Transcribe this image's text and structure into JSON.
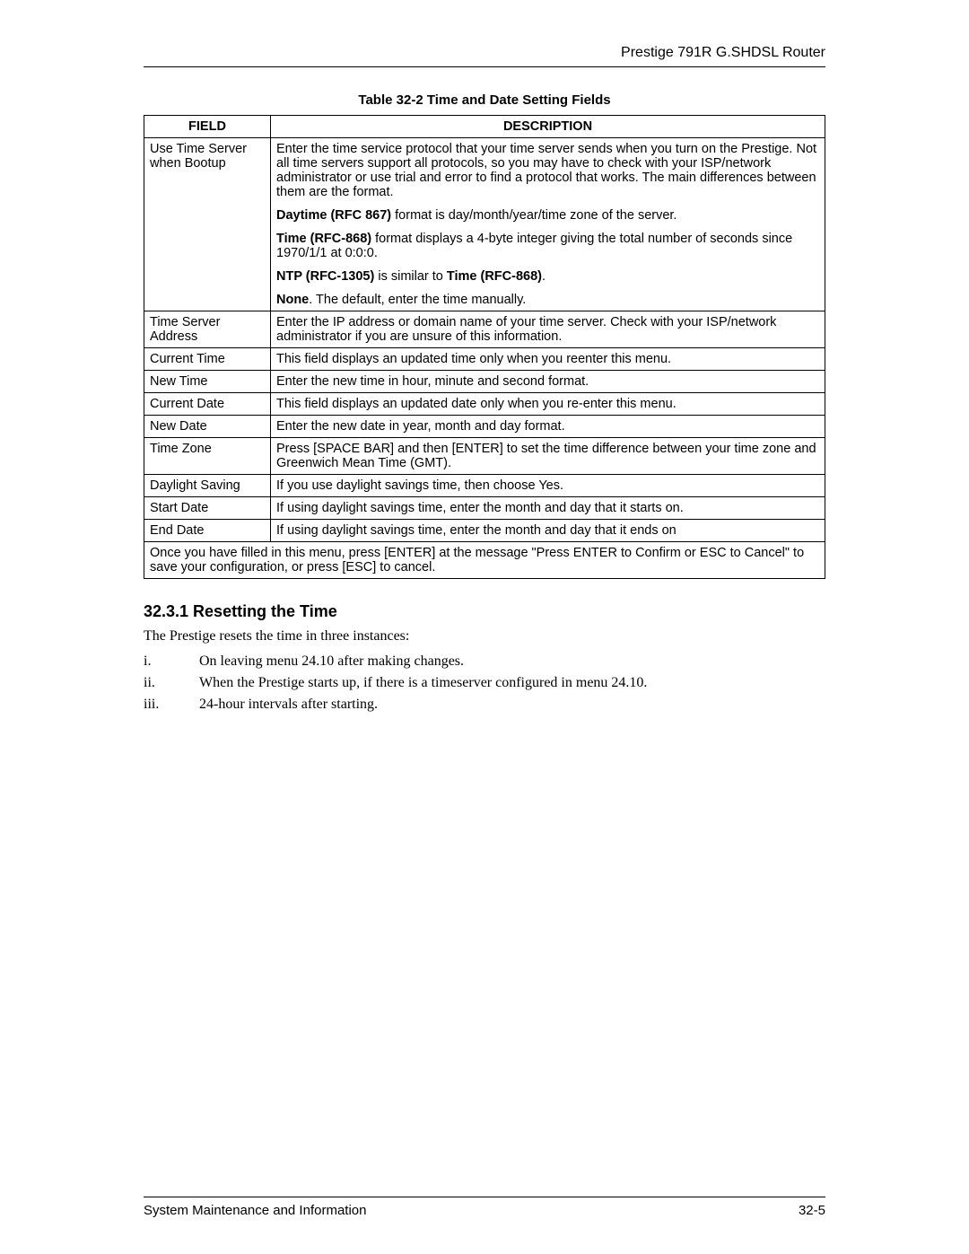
{
  "header": {
    "title": "Prestige 791R G.SHDSL Router"
  },
  "table": {
    "caption": "Table 32-2 Time and Date Setting Fields",
    "column_field": "FIELD",
    "column_desc": "DESCRIPTION",
    "rows": [
      {
        "field": "Use Time Server when Bootup",
        "desc_p1": "Enter the time service protocol that your time server sends when you turn on the Prestige. Not all time servers support all protocols, so you may have to check with your ISP/network administrator or use trial and error to find a protocol that works. The main differences between them are the format.",
        "desc_p2_b": "Daytime (RFC 867)",
        "desc_p2_t": " format is day/month/year/time zone of the server.",
        "desc_p3_b": "Time (RFC-868)",
        "desc_p3_t": " format displays a 4-byte integer giving the total number of seconds since 1970/1/1 at 0:0:0.",
        "desc_p4_b1": "NTP (RFC-1305)",
        "desc_p4_mid": " is similar to ",
        "desc_p4_b2": "Time (RFC-868)",
        "desc_p4_end": ".",
        "desc_p5_b": "None",
        "desc_p5_t": ". The default, enter the time manually."
      },
      {
        "field": "Time Server Address",
        "desc": "Enter the IP address or domain name of your time server. Check with your ISP/network administrator if you are unsure of this information."
      },
      {
        "field": "Current Time",
        "desc": "This field displays an updated time only when you reenter this menu."
      },
      {
        "field": "New Time",
        "desc": "Enter the new time in hour, minute and second format."
      },
      {
        "field": "Current Date",
        "desc": "This field displays an updated date only when you re-enter this menu."
      },
      {
        "field": "New Date",
        "desc": "Enter the new date in year, month and day format."
      },
      {
        "field": "Time Zone",
        "desc": "Press [SPACE BAR] and then [ENTER] to set the time difference between your time zone and Greenwich Mean Time (GMT)."
      },
      {
        "field": "Daylight Saving",
        "desc_pre": "If you use daylight savings time, then choose ",
        "desc_bold": "Yes",
        "desc_post": "."
      },
      {
        "field": "Start Date",
        "desc": "If using daylight savings time, enter the month and day that it starts on."
      },
      {
        "field": "End Date",
        "desc": "If using daylight savings time, enter the month and day that it ends on"
      }
    ],
    "footer_note": "Once you have filled in this menu, press [ENTER] at the message \"Press ENTER to Confirm or ESC to Cancel\" to save your configuration, or press [ESC] to cancel."
  },
  "section": {
    "heading": "32.3.1 Resetting the Time",
    "intro": "The Prestige resets the time in three instances:",
    "items": [
      {
        "num": "i.",
        "text": "On leaving menu 24.10 after making changes."
      },
      {
        "num": "ii.",
        "text": "When the Prestige starts up, if there is a timeserver configured in menu 24.10."
      },
      {
        "num": "iii.",
        "text": "24-hour intervals after starting."
      }
    ]
  },
  "footer": {
    "left": "System Maintenance and Information",
    "right": "32-5"
  }
}
